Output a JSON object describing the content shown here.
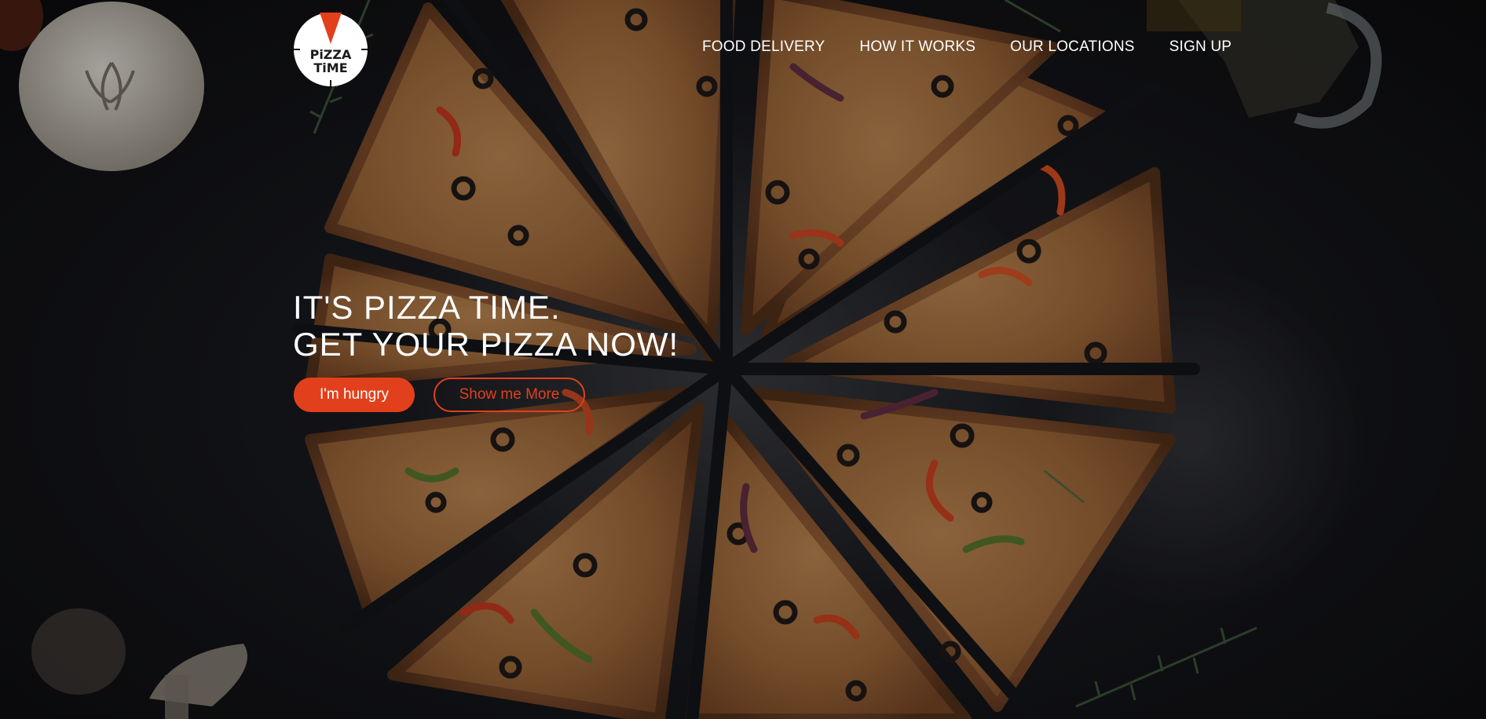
{
  "brand": {
    "logo_line1": "PiZZA",
    "logo_line2": "TiME",
    "accent_color": "#e2401c"
  },
  "nav": {
    "items": [
      {
        "label": "FOOD DELIVERY"
      },
      {
        "label": "HOW IT WORKS"
      },
      {
        "label": "OUR LOCATIONS"
      },
      {
        "label": "SIGN UP"
      }
    ]
  },
  "hero": {
    "headline_line1": "IT'S PIZZA TIME.",
    "headline_line2": "GET YOUR PIZZA NOW!",
    "primary_button": "I'm hungry",
    "secondary_button": "Show me More"
  }
}
